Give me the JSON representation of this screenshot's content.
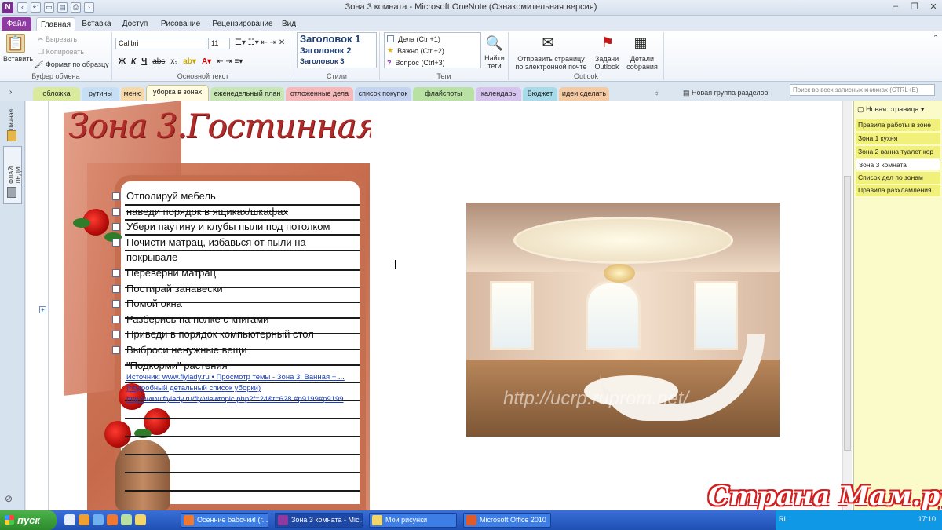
{
  "window": {
    "title": "Зона 3 комната - Microsoft OneNote (Ознакомительная версия)"
  },
  "ribbon_tabs": [
    "Файл",
    "Главная",
    "Вставка",
    "Доступ",
    "Рисование",
    "Рецензирование",
    "Вид"
  ],
  "clipboard": {
    "paste": "Вставить",
    "cut": "Вырезать",
    "copy": "Копировать",
    "format_painter": "Формат по образцу",
    "label": "Буфер обмена"
  },
  "basic_text": {
    "font": "Calibri",
    "size": "11",
    "label": "Основной текст"
  },
  "styles": {
    "h1": "Заголовок 1",
    "h2": "Заголовок 2",
    "h3": "Заголовок 3",
    "label": "Стили"
  },
  "tags": {
    "todo": "Дела (Ctrl+1)",
    "important": "Важно (Ctrl+2)",
    "question": "Вопрос (Ctrl+3)",
    "label": "Теги",
    "find": "Найти теги"
  },
  "outlook": {
    "email": "Отправить страницу по электронной почте",
    "tasks": "Задачи Outlook",
    "meeting": "Детали собрания",
    "label": "Outlook"
  },
  "sections": [
    "обложка",
    "рутины",
    "меню",
    "уборка в зонах",
    "еженедельный план",
    "отложенные дела",
    "список покупок",
    "флайспоты",
    "календарь",
    "Бюджет",
    "идеи сделать"
  ],
  "section_colors": [
    "#d9ea9c",
    "#c7dff4",
    "#f7d8a9",
    "#fff4a8",
    "#c7e6b4",
    "#f6b8b8",
    "#c4d3f0",
    "#b9e1a3",
    "#d6c4ee",
    "#a7dbe9",
    "#f5c9a2"
  ],
  "new_section_group": "Новая группа разделов",
  "search_placeholder": "Поиск во всех записных книжках (CTRL+E)",
  "notebooks": [
    "Личная",
    "ФЛАЙ ЛЕДИ"
  ],
  "page": {
    "title": "Зона 3.Гостинная",
    "checklist": [
      "Отполируй мебель",
      "наведи порядок в ящиках/шкафах",
      "Убери паутину и клубы пыли под потолком",
      "Почисти матрац, избавься от пыли на покрывале",
      "Переверни матрац",
      "Постирай занавески",
      "Помой окна",
      "Разберись на полке с книгами",
      "Приведи в порядок компьютерный стол",
      "Выброси ненужные вещи",
      "\"Подкорми\" растения"
    ],
    "link_text": "Источник: www.flylady.ru • Просмотр темы - Зона 3: Ванная + ... (подробный детальный список уборки) http://www.flylady.ru/fly/viewtopic.php?f=24&t=628 #p9199#p9199",
    "photo_watermark": "http://ucrp.ruprom.net/"
  },
  "pages_panel": {
    "new_page": "Новая страница",
    "items": [
      "Правила работы в зоне",
      "Зона 1 кухня",
      "Зона 2 ванна туалет кор",
      "Зона 3 комната",
      "Список дел по зонам",
      "Правила разхламления"
    ],
    "active_index": 3
  },
  "taskbar": {
    "start": "пуск",
    "tasks": [
      "Осенние бабочки! (г...",
      "Зона 3 комната - Mic...",
      "Мои рисунки",
      "Microsoft Office 2010"
    ],
    "lang": "RL",
    "clock": "17:10"
  },
  "site_watermark": "Страна Мам.ру"
}
